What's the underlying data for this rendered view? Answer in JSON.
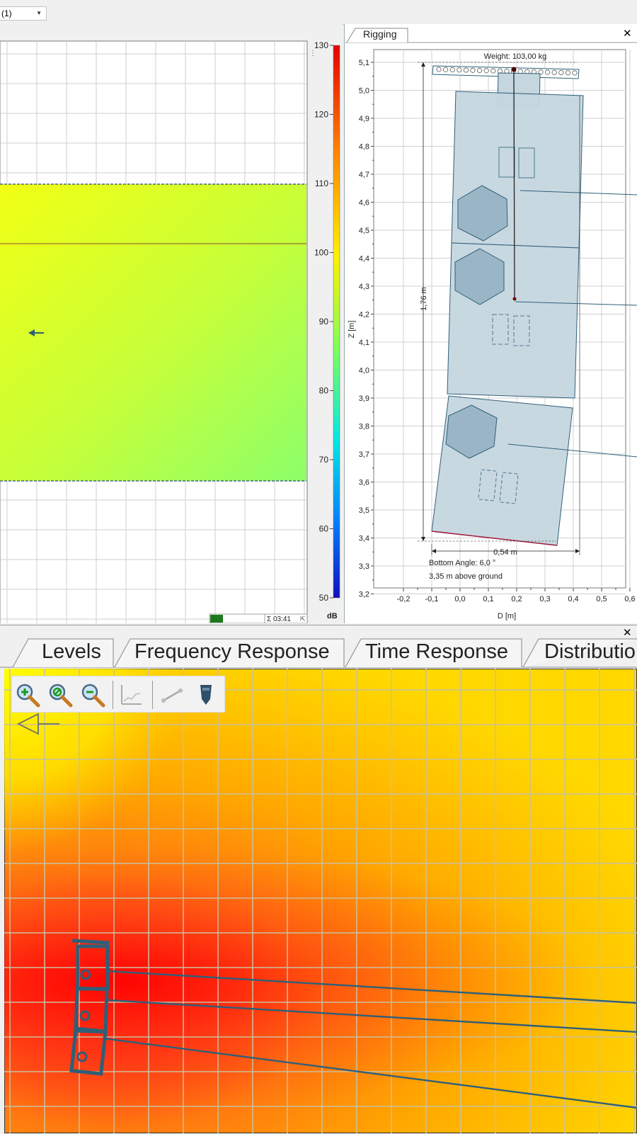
{
  "top_combo": {
    "value": "(1)"
  },
  "level_view": {
    "colorbar": {
      "unit": "dB",
      "ticks": [
        "130",
        "120",
        "110",
        "100",
        "90",
        "80",
        "70",
        "60",
        "50"
      ]
    },
    "status": {
      "time_label": "Σ 03:41"
    }
  },
  "rigging": {
    "tab_label": "Rigging",
    "weight_label": "Weight: 103,00 kg",
    "height_dim_label": "1,76 m",
    "depth_dim_label": "0,54 m",
    "bottom_angle_label": "Bottom Angle: 6,0 °",
    "ground_label": "3,35 m above ground",
    "xlabel": "D [m]",
    "ylabel": "Z [m]",
    "x_ticks": [
      "-0,2",
      "-0,1",
      "0,0",
      "0,1",
      "0,2",
      "0,3",
      "0,4",
      "0,5",
      "0,6"
    ],
    "y_ticks": [
      "5,1",
      "5,0",
      "4,9",
      "4,8",
      "4,7",
      "4,6",
      "4,5",
      "4,4",
      "4,3",
      "4,2",
      "4,1",
      "4,0",
      "3,9",
      "3,8",
      "3,7",
      "3,6",
      "3,5",
      "3,4",
      "3,3",
      "3,2"
    ]
  },
  "bottom_tabs": [
    {
      "label": "Levels"
    },
    {
      "label": "Frequency Response"
    },
    {
      "label": "Time Response"
    },
    {
      "label": "Distributio"
    }
  ],
  "toolbar": {
    "icons": [
      "zoom-in-icon",
      "zoom-fit-icon",
      "zoom-out-icon",
      "graph-icon",
      "measure-icon",
      "speaker-icon"
    ]
  },
  "colors": {
    "accent": "#2f5f78",
    "box_fill": "#c5d6df",
    "heat_hot": "#ff1a1a",
    "heat_warm": "#ffd200",
    "grid": "#c8c8c8"
  }
}
